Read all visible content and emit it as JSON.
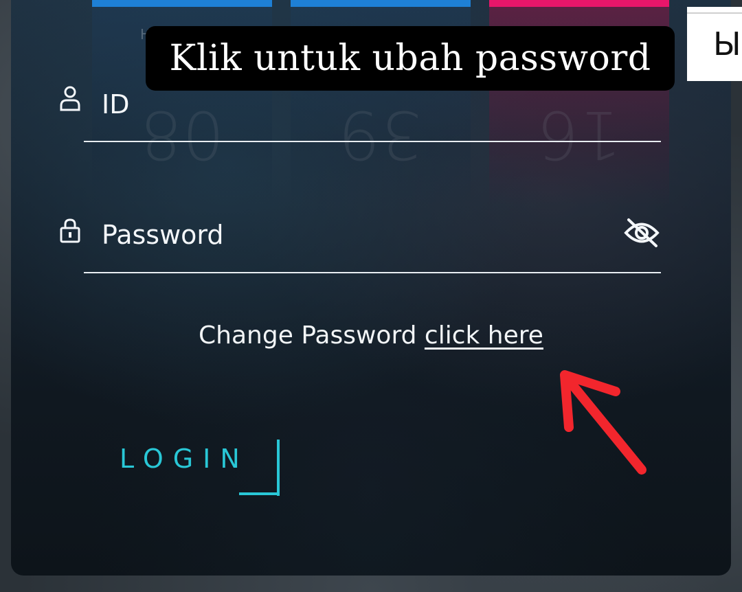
{
  "tooltip": {
    "text": "Klik untuk ubah password"
  },
  "background_columns": [
    {
      "digits": "08",
      "hint": "H",
      "bar_color": "#1e80d6"
    },
    {
      "digits": "39",
      "hint": "",
      "bar_color": "#1e80d6"
    },
    {
      "digits": "16",
      "hint": "",
      "bar_color": "#e8166a"
    }
  ],
  "side_card": {
    "text": "Ы"
  },
  "form": {
    "id_field": {
      "label": "ID",
      "icon": "user-icon"
    },
    "password_field": {
      "label": "Password",
      "icon": "lock-icon",
      "toggle_icon": "eye-off-icon"
    },
    "change_password": {
      "prefix": "Change Password ",
      "link": "click here"
    },
    "login_button": {
      "label": "LOGIN"
    }
  },
  "annotation": {
    "arrow_color": "#f2262d",
    "icon": "red-arrow-icon"
  },
  "colors": {
    "accent": "#29c7d6",
    "tooltip_bg": "#000000",
    "text": "#f4f7fa"
  }
}
